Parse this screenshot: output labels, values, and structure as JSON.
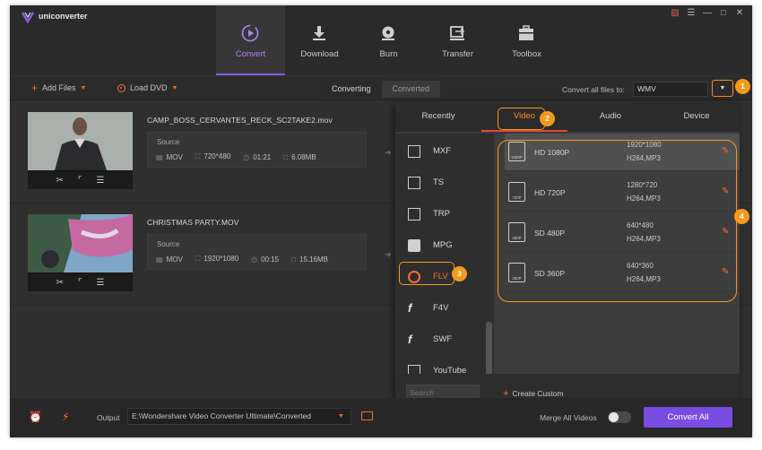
{
  "app": {
    "name": "uniconverter"
  },
  "nav": [
    {
      "label": "Convert",
      "icon": "convert-icon",
      "active": true
    },
    {
      "label": "Download",
      "icon": "download-icon"
    },
    {
      "label": "Burn",
      "icon": "burn-icon"
    },
    {
      "label": "Transfer",
      "icon": "transfer-icon"
    },
    {
      "label": "Toolbox",
      "icon": "toolbox-icon"
    }
  ],
  "toolbar": {
    "add_files": "Add Files",
    "load_dvd": "Load DVD",
    "tab_converting": "Converting",
    "tab_converted": "Converted",
    "convert_all_label": "Convert all files to:",
    "format_value": "WMV"
  },
  "files": [
    {
      "name": "CAMP_BOSS_CERVANTES_RECK_SC2TAKE2.mov",
      "source_label": "Source",
      "format": "MOV",
      "resolution": "720*480",
      "duration": "01:21",
      "size": "6.08MB"
    },
    {
      "name": "CHRISTMAS PARTY.MOV",
      "source_label": "Source",
      "format": "MOV",
      "resolution": "1920*1080",
      "duration": "00:15",
      "size": "15.16MB"
    }
  ],
  "popup": {
    "tabs": [
      "Recently",
      "Video",
      "Audio",
      "Device"
    ],
    "selected_tab": "Video",
    "formats": [
      "MXF",
      "TS",
      "TRP",
      "MPG",
      "FLV",
      "F4V",
      "SWF",
      "YouTube"
    ],
    "selected_format": "FLV",
    "presets": [
      {
        "name": "HD 1080P",
        "badge": "1080P",
        "resolution": "1920*1080",
        "codec": "H264,MP3"
      },
      {
        "name": "HD 720P",
        "badge": "720P",
        "resolution": "1280*720",
        "codec": "H264,MP3"
      },
      {
        "name": "SD 480P",
        "badge": "480P",
        "resolution": "640*480",
        "codec": "H264,MP3"
      },
      {
        "name": "SD 360P",
        "badge": "360P",
        "resolution": "640*360",
        "codec": "H264,MP3"
      }
    ],
    "search_placeholder": "Search",
    "create_custom": "Create Custom"
  },
  "callouts": [
    "1",
    "2",
    "3",
    "4"
  ],
  "bottom": {
    "output_label": "Output",
    "output_path": "E:\\Wondershare Video Converter Ultimate\\Converted",
    "merge_label": "Merge All Videos",
    "merge_enabled": false,
    "convert_all": "Convert All"
  },
  "colors": {
    "accent": "#8b5cf0",
    "orange": "#ff6a3a",
    "callout": "#f39a1e",
    "button": "#7a4de2"
  }
}
